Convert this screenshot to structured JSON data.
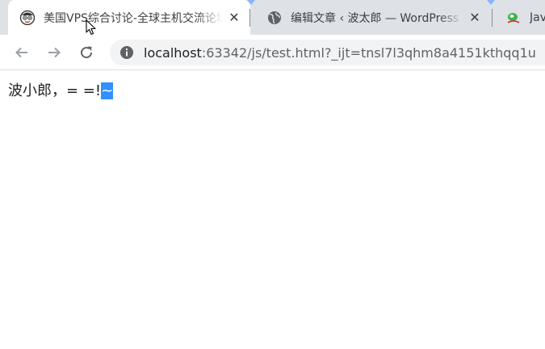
{
  "tabs": [
    {
      "title": "美国VPS综合讨论-全球主机交流论坛",
      "icon": "cartoon-avatar-icon",
      "active": true
    },
    {
      "title": "编辑文章 ‹ 波太郎 — WordPress",
      "icon": "globe-icon",
      "active": false
    },
    {
      "title": "Java",
      "icon": "green-leaf-icon",
      "active": false
    }
  ],
  "toolbar": {
    "url_host": "localhost",
    "url_rest": ":63342/js/test.html?_ijt=tnsl7l3qhm8a4151kthqq1u"
  },
  "page": {
    "text": "波小郎，= =!",
    "selected_text": "~"
  },
  "colors": {
    "tabstrip_bg": "#dee1e6",
    "selection": "#3390ff",
    "omnibox_bg": "#f1f3f4"
  }
}
